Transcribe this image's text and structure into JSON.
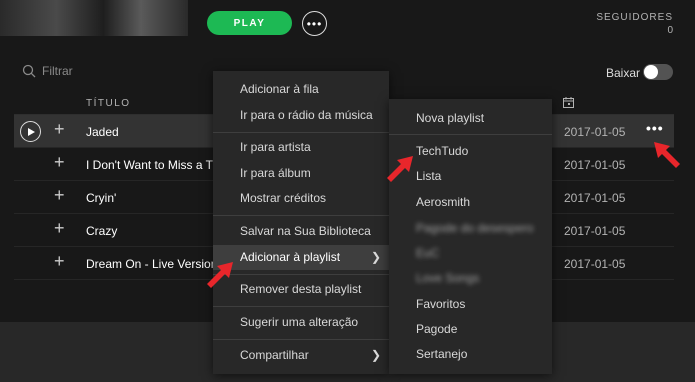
{
  "header": {
    "play_label": "PLAY",
    "more_label": "•••",
    "followers_label": "SEGUIDORES",
    "followers_count": "0"
  },
  "toolbar": {
    "filter_placeholder": "Filtrar",
    "download_label": "Baixar"
  },
  "table": {
    "title_header": "TÍTULO",
    "rows": [
      {
        "title": "Jaded",
        "date": "2017-01-05"
      },
      {
        "title": "I Don't Want to Miss a Thing",
        "date": "2017-01-05"
      },
      {
        "title": "Cryin'",
        "date": "2017-01-05"
      },
      {
        "title": "Crazy",
        "date": "2017-01-05"
      },
      {
        "title": "Dream On - Live Version",
        "date": "2017-01-05"
      }
    ],
    "row_more_label": "•••"
  },
  "context_menu": {
    "items": [
      "Adicionar à fila",
      "Ir para o rádio da música",
      "Ir para artista",
      "Ir para álbum",
      "Mostrar créditos",
      "Salvar na Sua Biblioteca",
      "Adicionar à playlist",
      "Remover desta playlist",
      "Sugerir uma alteração",
      "Compartilhar"
    ]
  },
  "playlist_menu": {
    "new_playlist": "Nova playlist",
    "items": [
      "TechTudo",
      "Lista",
      "Aerosmith",
      "Pagode do desespero",
      "EuC",
      "Love Songs",
      "Favoritos",
      "Pagode",
      "Sertanejo"
    ]
  },
  "colors": {
    "accent": "#1db954",
    "arrow": "#e8262b"
  }
}
